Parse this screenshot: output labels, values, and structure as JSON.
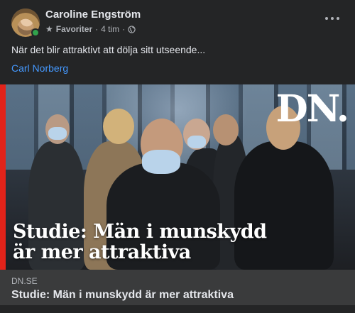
{
  "post": {
    "author": "Caroline Engström",
    "audience_label": "Favoriter",
    "separator": "·",
    "time": "4 tim",
    "separator2": "·",
    "message": "När det blir attraktivt att dölja sitt utseende...",
    "mention": "Carl Norberg"
  },
  "link_preview": {
    "image_headline_line1": "Studie: Män i munskydd",
    "image_headline_line2": "är mer attraktiva",
    "logo_text": "DN.",
    "domain": "DN.SE",
    "title": "Studie: Män i munskydd är mer attraktiva"
  },
  "icons": {
    "star": "star-icon",
    "globe": "globe-icon",
    "more": "more-options-icon"
  },
  "colors": {
    "background": "#242526",
    "link_box": "#3a3b3c",
    "mention": "#4599ff",
    "online": "#31a24c",
    "brand_red": "#e2231a"
  }
}
